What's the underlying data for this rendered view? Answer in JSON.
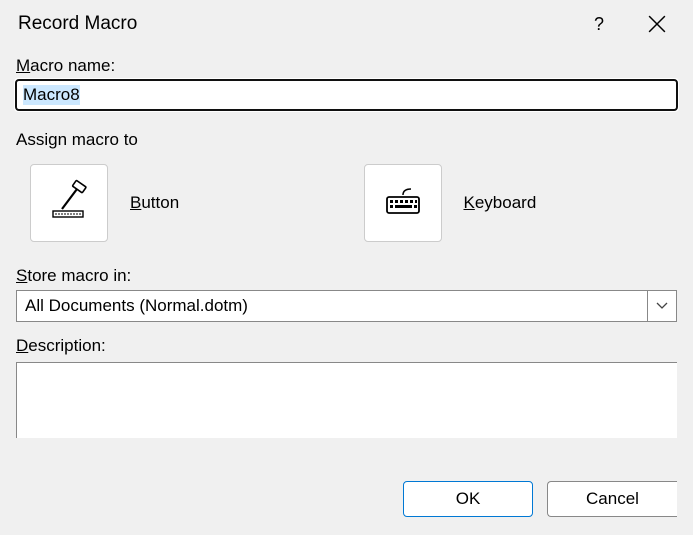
{
  "dialog": {
    "title": "Record Macro",
    "help_symbol": "?"
  },
  "macroName": {
    "label_prefix": "M",
    "label_rest": "acro name:",
    "value": "Macro8"
  },
  "assign": {
    "label": "Assign macro to",
    "button": {
      "label_prefix": "B",
      "label_rest": "utton"
    },
    "keyboard": {
      "label_prefix": "K",
      "label_rest": "eyboard"
    }
  },
  "store": {
    "label_prefix": "S",
    "label_rest": "tore macro in:",
    "value": "All Documents (Normal.dotm)"
  },
  "description": {
    "label_prefix": "D",
    "label_rest": "escription:",
    "value": ""
  },
  "buttons": {
    "ok": "OK",
    "cancel": "Cancel"
  }
}
